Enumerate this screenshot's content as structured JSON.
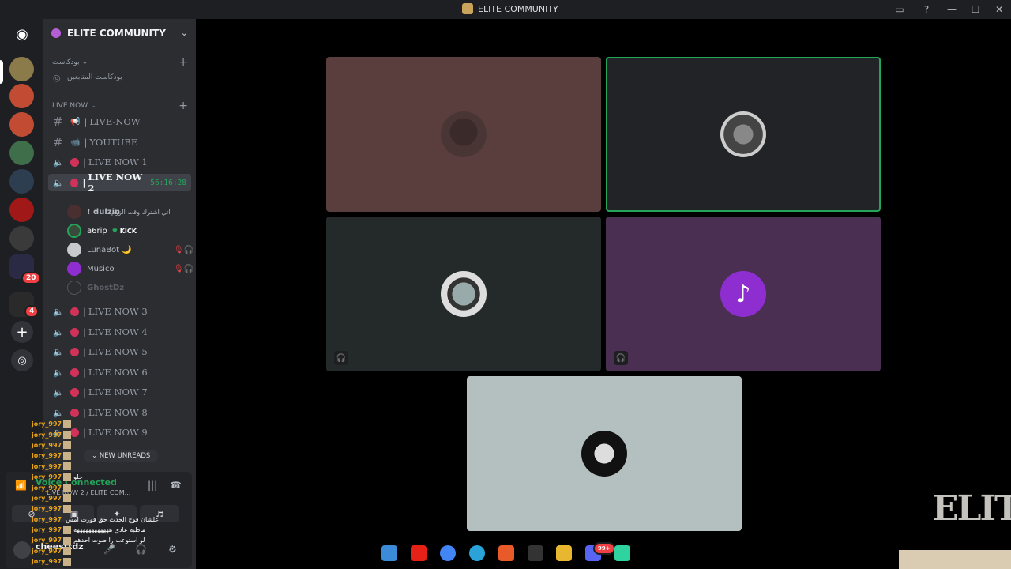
{
  "window": {
    "title": "ELITE COMMUNITY"
  },
  "rail": {
    "badges": {
      "server1": "",
      "folder1": "20",
      "folder2": "4",
      "discord_task": "99+"
    }
  },
  "sidebar": {
    "guild_name": "ELITE COMMUNITY",
    "categories": {
      "podcast": "بودكاست",
      "podcast_channel": "بودكاست المتابعين",
      "live_now": "LIVE NOW"
    },
    "channels": [
      {
        "name": "LIVE-NOW"
      },
      {
        "name": "YOUTUBE"
      },
      {
        "name": "LIVE NOW 1"
      },
      {
        "name": "LIVE NOW 2",
        "timer": "56:16:28",
        "status": "اتي اشترك وقت الزوم"
      },
      {
        "name": "LIVE NOW 3"
      },
      {
        "name": "LIVE NOW 4"
      },
      {
        "name": "LIVE NOW 5"
      },
      {
        "name": "LIVE NOW 6"
      },
      {
        "name": "LIVE NOW 7"
      },
      {
        "name": "LIVE NOW 8"
      },
      {
        "name": "LIVE NOW 9"
      }
    ],
    "voice_users": [
      {
        "name": "! dulzin"
      },
      {
        "name": "a6rip",
        "tag": "KICK"
      },
      {
        "name": "LunaBot 🌙"
      },
      {
        "name": "Musico"
      },
      {
        "name": "GhostDz"
      }
    ],
    "new_unreads": "NEW UNREADS"
  },
  "voice_panel": {
    "title": "Voice Connected",
    "subtitle": "LIVE NOW 2 / ELITE COM...",
    "username": "cheesttdz"
  },
  "overlay": {
    "lines": [
      {
        "user": "jory_997",
        "msg": ""
      },
      {
        "user": "jory_997",
        "msg": ""
      },
      {
        "user": "jory_997",
        "msg": ""
      },
      {
        "user": "jory_997",
        "msg": ""
      },
      {
        "user": "jory_997",
        "msg": ""
      },
      {
        "user": "jory_997",
        "msg": "حلو"
      },
      {
        "user": "jory_997",
        "msg": ""
      },
      {
        "user": "jory_997",
        "msg": ""
      },
      {
        "user": "jory_997",
        "msg": ""
      },
      {
        "user": "jory_997",
        "msg": "علشان فوج الحدث حق فورت امس"
      },
      {
        "user": "jory_997",
        "msg": "ماظبه عادي ههههههههههههه"
      },
      {
        "user": "jory_997",
        "msg": "لو استوعب را صوت احدهم"
      },
      {
        "user": "jory_997",
        "msg": ""
      },
      {
        "user": "jory_997",
        "msg": ""
      }
    ]
  },
  "stage": {
    "tiles": [
      {
        "bg": "#5a3d3d",
        "speaking": false
      },
      {
        "bg": "#222326",
        "speaking": true
      },
      {
        "bg": "#232a29",
        "speaking": false
      },
      {
        "bg": "#4a2f52",
        "speaking": false
      },
      {
        "bg": "#b4c0bf",
        "speaking": false
      }
    ]
  },
  "watermark": "ELITE"
}
